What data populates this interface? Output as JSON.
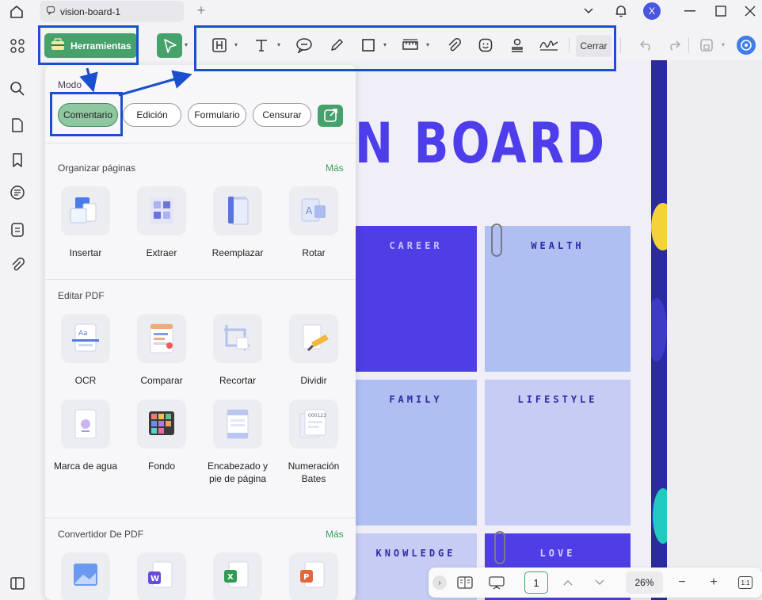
{
  "titlebar": {
    "tab_title": "vision-board-1",
    "new_tab": "+",
    "avatar_initial": "X"
  },
  "toolbar": {
    "tools_label": "Herramientas",
    "close_label": "Cerrar",
    "accent_color": "#46a16b",
    "annotation_color": "#1a4fd0"
  },
  "panel": {
    "mode_heading": "Modo",
    "modes": [
      "Comentario",
      "Edición",
      "Formulario",
      "Censurar"
    ],
    "active_mode": "Comentario",
    "sections": [
      {
        "title": "Organizar páginas",
        "more": "Más",
        "items": [
          "Insertar",
          "Extraer",
          "Reemplazar",
          "Rotar"
        ]
      },
      {
        "title": "Editar PDF",
        "items": [
          "OCR",
          "Comparar",
          "Recortar",
          "Dividir",
          "Marca de agua",
          "Fondo",
          "Encabezado y pie de página",
          "Numeración Bates"
        ]
      },
      {
        "title": "Convertidor De PDF",
        "more": "Más"
      }
    ]
  },
  "document": {
    "title": "N BOARD",
    "tiles": [
      "CAREER",
      "WEALTH",
      "FAMILY",
      "LIFESTYLE",
      "KNOWLEDGE",
      "LOVE"
    ],
    "title_color": "#4d3dea"
  },
  "bottombar": {
    "page": "1",
    "zoom": "26%",
    "fit_label": "1:1",
    "zoom_out": "−",
    "zoom_in": "+"
  }
}
